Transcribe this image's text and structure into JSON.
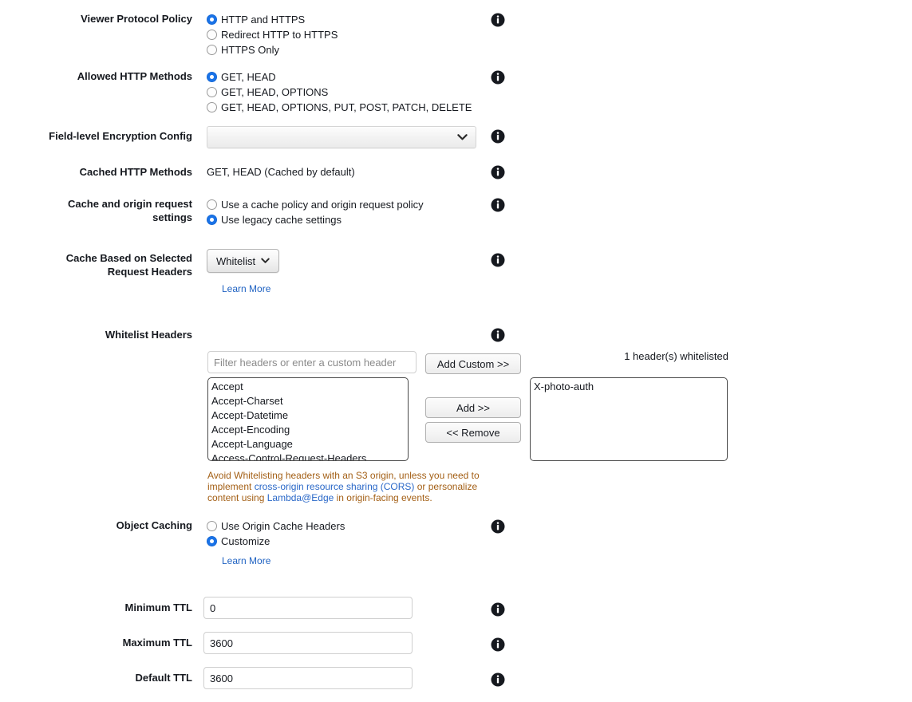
{
  "rows": {
    "viewer_protocol": {
      "label": "Viewer Protocol Policy",
      "options": [
        {
          "label": "HTTP and HTTPS",
          "selected": true
        },
        {
          "label": "Redirect HTTP to HTTPS",
          "selected": false
        },
        {
          "label": "HTTPS Only",
          "selected": false
        }
      ]
    },
    "allowed_methods": {
      "label": "Allowed HTTP Methods",
      "options": [
        {
          "label": "GET, HEAD",
          "selected": true
        },
        {
          "label": "GET, HEAD, OPTIONS",
          "selected": false
        },
        {
          "label": "GET, HEAD, OPTIONS, PUT, POST, PATCH, DELETE",
          "selected": false
        }
      ]
    },
    "field_level_encryption": {
      "label": "Field-level Encryption Config",
      "value": "",
      "icon": "chevron-down-icon"
    },
    "cached_methods": {
      "label": "Cached HTTP Methods",
      "value": "GET, HEAD (Cached by default)"
    },
    "cache_origin_request": {
      "label_line1": "Cache and origin request",
      "label_line2": "settings",
      "options": [
        {
          "label": "Use a cache policy and origin request policy",
          "selected": false
        },
        {
          "label": "Use legacy cache settings",
          "selected": true
        }
      ]
    },
    "cache_based_headers": {
      "label_line1": "Cache Based on Selected",
      "label_line2": "Request Headers",
      "button_label": "Whitelist",
      "button_icon": "chevron-down-icon",
      "learn_more": "Learn More"
    },
    "whitelist_headers": {
      "label": "Whitelist Headers",
      "filter_placeholder": "Filter headers or enter a custom header",
      "filter_value": "",
      "add_custom_label": "Add Custom >>",
      "add_label": "Add >>",
      "remove_label": "<< Remove",
      "available_headers": [
        "Accept",
        "Accept-Charset",
        "Accept-Datetime",
        "Accept-Encoding",
        "Accept-Language",
        "Access-Control-Request-Headers"
      ],
      "selected_headers": [
        "X-photo-auth"
      ],
      "count_text": "1 header(s) whitelisted",
      "warning": {
        "part1": "Avoid Whitelisting headers with an S3 origin, unless you need to implement ",
        "link1": "cross-origin resource sharing (CORS)",
        "part2": " or personalize content using ",
        "link2": "Lambda@Edge",
        "part3": " in origin-facing events."
      }
    },
    "object_caching": {
      "label": "Object Caching",
      "options": [
        {
          "label": "Use Origin Cache Headers",
          "selected": false
        },
        {
          "label": "Customize",
          "selected": true
        }
      ],
      "learn_more": "Learn More"
    },
    "minimum_ttl": {
      "label": "Minimum TTL",
      "value": "0"
    },
    "maximum_ttl": {
      "label": "Maximum TTL",
      "value": "3600"
    },
    "default_ttl": {
      "label": "Default TTL",
      "value": "3600"
    }
  },
  "icons": {
    "info": "info-icon"
  },
  "colors": {
    "accent_blue": "#1a73e8",
    "link_blue": "#1f62c2",
    "warning_orange": "#a35f15",
    "text": "#16191f"
  }
}
